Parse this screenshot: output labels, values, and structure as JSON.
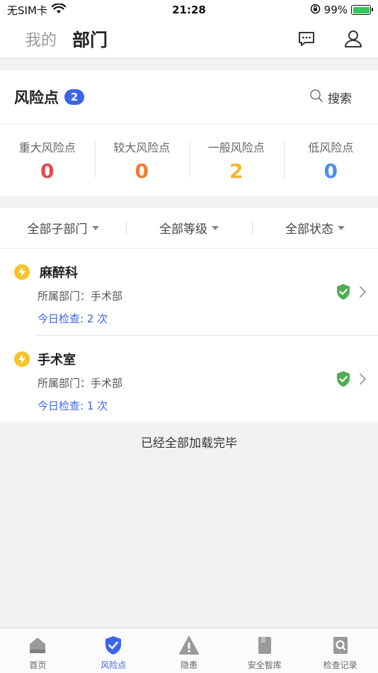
{
  "status_bar": {
    "carrier": "无SIM卡",
    "time": "21:28",
    "battery": "99%"
  },
  "header": {
    "tab_mine": "我的",
    "tab_dept": "部门"
  },
  "risk": {
    "title": "风险点",
    "count": "2",
    "search_label": "搜索",
    "stats": [
      {
        "label": "重大风险点",
        "value": "0",
        "color": "#e5484d"
      },
      {
        "label": "较大风险点",
        "value": "0",
        "color": "#f07c33"
      },
      {
        "label": "一般风险点",
        "value": "2",
        "color": "#f2b632"
      },
      {
        "label": "低风险点",
        "value": "0",
        "color": "#4a8ef0"
      }
    ]
  },
  "filters": [
    {
      "label": "全部子部门"
    },
    {
      "label": "全部等级"
    },
    {
      "label": "全部状态"
    }
  ],
  "items": [
    {
      "name": "麻醉科",
      "dept": "所属部门：手术部",
      "check": "今日检查: 2 次"
    },
    {
      "name": "手术室",
      "dept": "所属部门：手术部",
      "check": "今日检查: 1 次"
    }
  ],
  "end_text": "已经全部加载完毕",
  "nav": [
    {
      "label": "首页",
      "icon": "home-icon"
    },
    {
      "label": "风险点",
      "icon": "shield-check-icon"
    },
    {
      "label": "隐患",
      "icon": "warning-icon"
    },
    {
      "label": "安全智库",
      "icon": "book-icon"
    },
    {
      "label": "检查记录",
      "icon": "search-doc-icon"
    }
  ],
  "colors": {
    "accent": "#3c64e8",
    "bolt": "#f5c428",
    "shield": "#4caf50"
  }
}
